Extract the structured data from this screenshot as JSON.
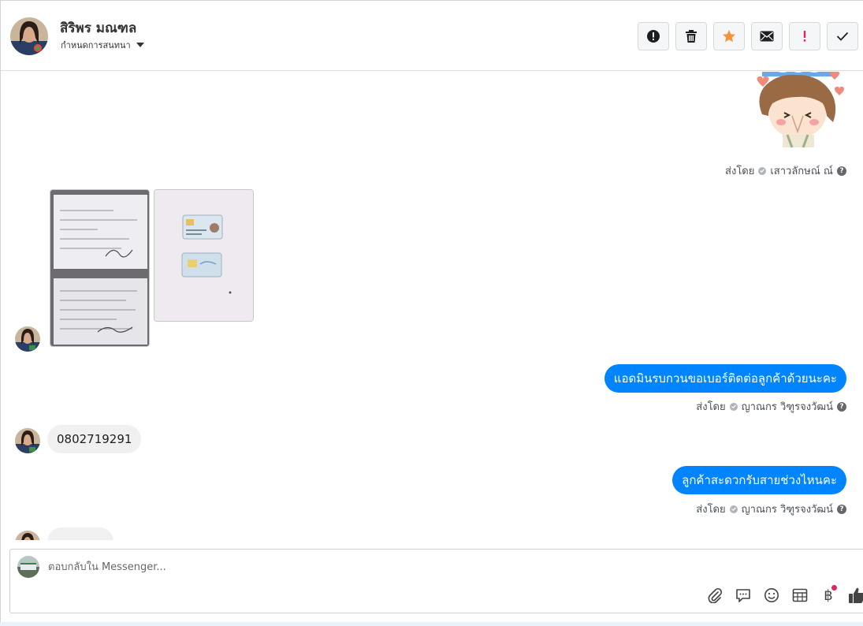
{
  "header": {
    "contact_name": "สิริพร มณฑล",
    "assign_label": "กำหนดการสนทนา",
    "actions": [
      {
        "name": "report-spam-button",
        "icon": "alert-circle-icon"
      },
      {
        "name": "delete-button",
        "icon": "trash-icon"
      },
      {
        "name": "star-button",
        "icon": "star-icon"
      },
      {
        "name": "mark-unread-button",
        "icon": "envelope-icon"
      },
      {
        "name": "mark-important-button",
        "icon": "exclamation-icon"
      },
      {
        "name": "mark-done-button",
        "icon": "check-icon"
      }
    ]
  },
  "messages": [
    {
      "type": "sticker",
      "direction": "out",
      "sender_label": "ส่งโดย",
      "sender": "เสาวลักษณ์ ณ์"
    },
    {
      "type": "images",
      "direction": "in",
      "images": [
        "document-photo",
        "id-card-photo"
      ]
    },
    {
      "type": "text",
      "direction": "out",
      "text": "แอดมินรบกวนขอเบอร์ติดต่อลูกค้าด้วยนะคะ",
      "sender_label": "ส่งโดย",
      "sender": "ญาณกร วิฑูรจงวัฒน์"
    },
    {
      "type": "text",
      "direction": "in",
      "text": "0802719291"
    },
    {
      "type": "text",
      "direction": "out",
      "text": "ลูกค้าสะดวกรับสายช่วงไหนคะ",
      "sender_label": "ส่งโดย",
      "sender": "ญาณกร วิฑูรจงวัฒน์"
    }
  ],
  "composer": {
    "placeholder": "ตอบกลับใน Messenger...",
    "tools": [
      "paperclip-icon",
      "chat-bubble-icon",
      "smiley-icon",
      "calendar-grid-icon",
      "baht-icon",
      "thumbs-up-icon"
    ],
    "baht_symbol": "฿"
  },
  "colors": {
    "outgoing_bubble": "#0084ff",
    "incoming_bubble": "#f1f0f0",
    "star_accent": "#f7923b",
    "alert_red": "#e0245e"
  }
}
